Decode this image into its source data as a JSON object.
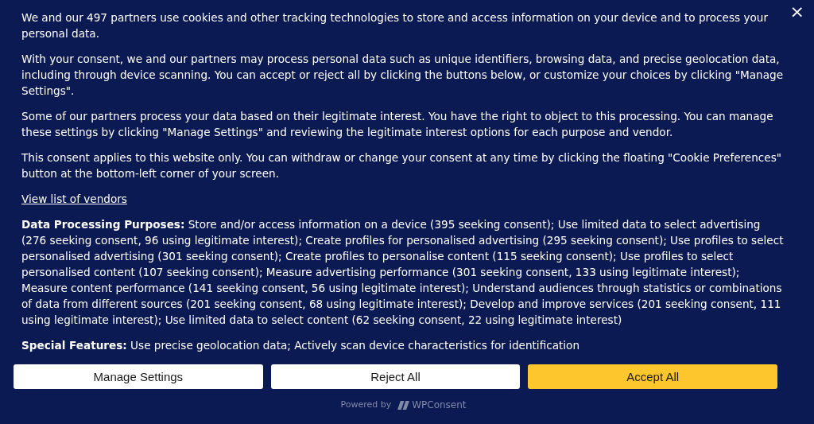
{
  "close": {
    "label": "×"
  },
  "paragraphs": [
    "We and our 497 partners use cookies and other tracking technologies to store and access information on your device and to process your personal data.",
    "With your consent, we and our partners may process personal data such as unique identifiers, browsing data, and precise geolocation data, including through device scanning. You can accept or reject all by clicking the buttons below, or customize your choices by clicking \"Manage Settings\".",
    "Some of our partners process your data based on their legitimate interest. You have the right to object to this processing. You can manage these settings by clicking \"Manage Settings\" and reviewing the legitimate interest options for each purpose and vendor.",
    "This consent applies to this website only. You can withdraw or change your consent at any time by clicking the floating \"Cookie Preferences\" button at the bottom-left corner of your screen."
  ],
  "vendors_link": "View list of vendors",
  "details": [
    "**Data Processing Purposes:** Store and/or access information on a device (395 seeking consent); Use limited data to select advertising (276 seeking consent, 96 using legitimate interest); Create profiles for personalised advertising (295 seeking consent); Use profiles to select personalised advertising (301 seeking consent); Create profiles to personalise content (115 seeking consent); Use profiles to select personalised content (107 seeking consent); Measure advertising performance (301 seeking consent, 133 using legitimate interest); Measure content performance (141 seeking consent, 56 using legitimate interest); Understand audiences through statistics or combinations of data from different sources (201 seeking consent, 68 using legitimate interest); Develop and improve services (201 seeking consent, 111 using legitimate interest); Use limited data to select content (62 seeking consent, 22 using legitimate interest)",
    "**Special Features:** Use precise geolocation data; Actively scan device characteristics for identification"
  ],
  "buttons": [
    {
      "label": "Manage Settings",
      "kind": "secondary"
    },
    {
      "label": "Reject All",
      "kind": "secondary"
    },
    {
      "label": "Accept All",
      "kind": "primary"
    }
  ],
  "footer": {
    "powered_by": "Powered by",
    "brand": "WPConsent"
  }
}
